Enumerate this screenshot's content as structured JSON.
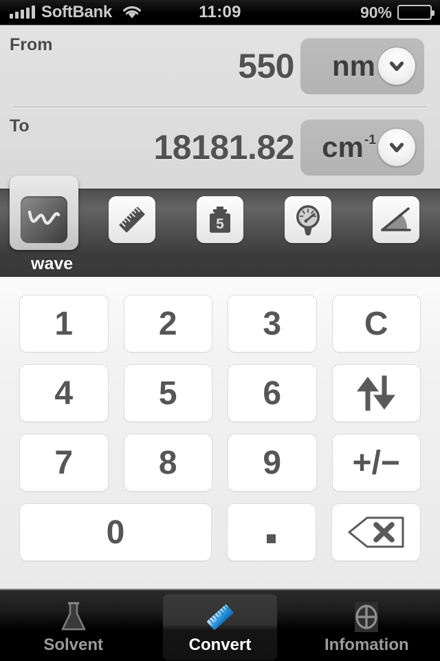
{
  "statusbar": {
    "carrier": "SoftBank",
    "time": "11:09",
    "battery_text": "90%",
    "battery_level": 90,
    "wifi_icon": "wifi-icon",
    "signal_icon": "signal-bars-icon"
  },
  "converter": {
    "from": {
      "label": "From",
      "value": "550",
      "unit": "nm",
      "unit_sup": "",
      "chevron_icon": "chevron-down-icon"
    },
    "to": {
      "label": "To",
      "value": "18181.82",
      "unit": "cm",
      "unit_sup": "-1",
      "chevron_icon": "chevron-down-icon"
    }
  },
  "categories": {
    "selected_index": 0,
    "selected_label": "wave",
    "items": [
      {
        "name": "wave",
        "label": "wave",
        "icon": "sine-wave-icon",
        "selected": true
      },
      {
        "name": "length",
        "label": "",
        "icon": "ruler-icon",
        "selected": false
      },
      {
        "name": "weight",
        "label": "",
        "icon": "weight-icon",
        "icon_text": "5",
        "selected": false
      },
      {
        "name": "pressure",
        "label": "",
        "icon": "pressure-gauge-icon",
        "selected": false
      },
      {
        "name": "angle",
        "label": "",
        "icon": "angle-icon",
        "selected": false
      }
    ]
  },
  "keypad": {
    "rows": [
      [
        {
          "name": "key-1",
          "label": "1",
          "type": "digit"
        },
        {
          "name": "key-2",
          "label": "2",
          "type": "digit"
        },
        {
          "name": "key-3",
          "label": "3",
          "type": "digit"
        },
        {
          "name": "key-clear",
          "label": "C",
          "type": "action"
        }
      ],
      [
        {
          "name": "key-4",
          "label": "4",
          "type": "digit"
        },
        {
          "name": "key-5",
          "label": "5",
          "type": "digit"
        },
        {
          "name": "key-6",
          "label": "6",
          "type": "digit"
        },
        {
          "name": "key-swap",
          "label": "",
          "type": "icon",
          "icon": "swap-arrows-icon"
        }
      ],
      [
        {
          "name": "key-7",
          "label": "7",
          "type": "digit"
        },
        {
          "name": "key-8",
          "label": "8",
          "type": "digit"
        },
        {
          "name": "key-9",
          "label": "9",
          "type": "digit"
        },
        {
          "name": "key-sign",
          "label": "+/−",
          "type": "action"
        }
      ],
      [
        {
          "name": "key-0",
          "label": "0",
          "type": "digit",
          "wide": true
        },
        {
          "name": "key-decimal",
          "label": ".",
          "type": "action"
        },
        {
          "name": "key-backspace",
          "label": "",
          "type": "icon",
          "icon": "backspace-icon"
        }
      ]
    ]
  },
  "tabbar": {
    "tabs": [
      {
        "name": "tab-solvent",
        "label": "Solvent",
        "icon": "flask-icon",
        "selected": false
      },
      {
        "name": "tab-convert",
        "label": "Convert",
        "icon": "ruler-icon",
        "selected": true
      },
      {
        "name": "tab-information",
        "label": "Infomation",
        "icon": "crosshair-circle-icon",
        "selected": false
      }
    ]
  },
  "colors": {
    "accent_blue": "#3aa8e8",
    "panel_bg": "#dedede",
    "key_text": "#565656",
    "tab_inactive": "#9a9a9a"
  }
}
